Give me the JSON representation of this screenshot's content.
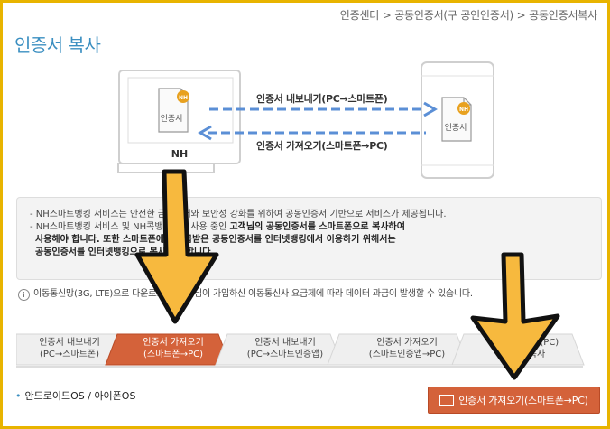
{
  "breadcrumb": "인증센터 > 공동인증서(구 공인인증서) > 공동인증서복사",
  "page_title": "인증서 복사",
  "diagram": {
    "pc_cert_label": "인증서",
    "pc_badge": "NH",
    "pc_brand": "NH",
    "phone_cert_label": "인증서",
    "phone_badge": "NH",
    "export_label": "인증서 내보내기(PC→스마트폰)",
    "import_label": "인증서 가져오기(스마트폰→PC)"
  },
  "notice": {
    "line1": "- NH스마트뱅킹 서비스는 안전한 금융거래와 보안성 강화를 위하여 공동인증서 기반으로 서비스가 제공됩니다.",
    "line2_a": "- NH스마트뱅킹 서비스 및 NH콕뱅킹에서 사용 중인 ",
    "line2_b": "고객님의 공동인증서를 스마트폰으로 복사하여",
    "line3": "사용해야 합니다. 또한 스마트폰에서 발급받은 공동인증서를 인터넷뱅킹에서 이용하기 위해서는",
    "line4": "공동인증서를 인터넷뱅킹으로 복사해야 합니다."
  },
  "info_text": "이동통신망(3G, LTE)으로 다운로드 시 고객님이 가입하신 이동통신사 요금제에 따라 데이터 과금이 발생할 수 있습니다.",
  "tabs": [
    {
      "line1": "인증서 내보내기",
      "line2": "(PC→스마트폰)"
    },
    {
      "line1": "인증서 가져오기",
      "line2": "(스마트폰→PC)"
    },
    {
      "line1": "인증서 내보내기",
      "line2": "(PC→스마트인증앱)"
    },
    {
      "line1": "인증서 가져오기",
      "line2": "(스마트인증앱→PC)"
    },
    {
      "line1": "인증서(PC)",
      "line2": "복사"
    }
  ],
  "platform_label": "안드로이드OS / 아이폰OS",
  "import_button": "인증서 가져오기(스마트폰→PC)",
  "colors": {
    "accent": "#3b8fc1",
    "active_tab": "#d4623a",
    "highlight_arrow": "#f7b93e"
  }
}
